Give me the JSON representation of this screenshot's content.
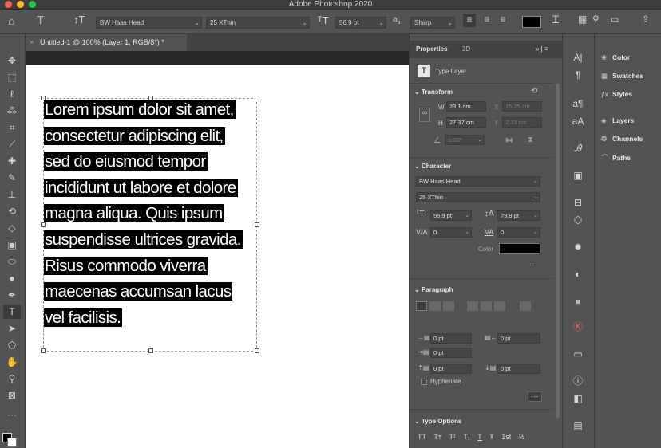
{
  "app": {
    "title": "Adobe Photoshop 2020"
  },
  "colors": {
    "accent": "#3b8fd6",
    "close": "#ff5f57",
    "minimize": "#febc2e",
    "zoom": "#28c840"
  },
  "options_bar": {
    "font_family": "BW Haas Head",
    "font_style": "25 XThin",
    "font_size": "56.9 pt",
    "aa_label": "a",
    "aa_icon_small": "a",
    "antialias": "Sharp",
    "icons": [
      "home-icon",
      "type-tool-icon",
      "toggle-orientation-icon",
      "font-size-icon",
      "align-left-icon",
      "align-center-icon",
      "align-right-icon",
      "warp-text-icon",
      "character-panel-icon",
      "search-icon",
      "workspace-icon",
      "share-icon"
    ]
  },
  "document": {
    "tab_title": "Untitled-1 @ 100% (Layer 1, RGB/8*) *",
    "text_lines": [
      "Lorem ipsum dolor sit amet,",
      "consectetur adipiscing elit,",
      "sed do eiusmod tempor",
      "incididunt ut labore et dolore",
      "magna aliqua. Quis ipsum",
      "suspendisse ultrices gravida.",
      "Risus commodo viverra",
      "maecenas accumsan lacus",
      "vel facilisis."
    ]
  },
  "properties": {
    "tabs": [
      "Properties",
      "3D"
    ],
    "layer_type": "Type Layer",
    "transform": {
      "title": "Transform",
      "w_label": "W",
      "w": "23.1 cm",
      "x_label": "X",
      "x": "15.25 cm",
      "h_label": "H",
      "h": "27.37 cm",
      "y_label": "Y",
      "y": "2.33 cm",
      "angle": "0.00°"
    },
    "character": {
      "title": "Character",
      "font_family": "BW Haas Head",
      "font_style": "25 XThin",
      "size": "56.9 pt",
      "leading": "79.9 pt",
      "kerning": "0",
      "tracking": "0",
      "color_label": "Color",
      "color": "#000000"
    },
    "paragraph": {
      "title": "Paragraph",
      "indent_left": "0 pt",
      "indent_right": "0 pt",
      "indent_first": "0 pt",
      "space_before": "0 pt",
      "space_after": "0 pt",
      "hyphenate_label": "Hyphenate",
      "hyphenate": false
    },
    "type_options": {
      "title": "Type Options",
      "buttons": [
        "TT",
        "Tт",
        "T¹",
        "T₁",
        "T",
        "Ŧ",
        "1st",
        "½"
      ]
    }
  },
  "right_panel": {
    "items": [
      {
        "label": "Color",
        "icon": "color-icon"
      },
      {
        "label": "Swatches",
        "icon": "swatches-icon"
      },
      {
        "label": "Styles",
        "icon": "styles-icon"
      },
      {
        "label": "Layers",
        "icon": "layers-icon"
      },
      {
        "label": "Channels",
        "icon": "channels-icon"
      },
      {
        "label": "Paths",
        "icon": "paths-icon"
      }
    ]
  }
}
